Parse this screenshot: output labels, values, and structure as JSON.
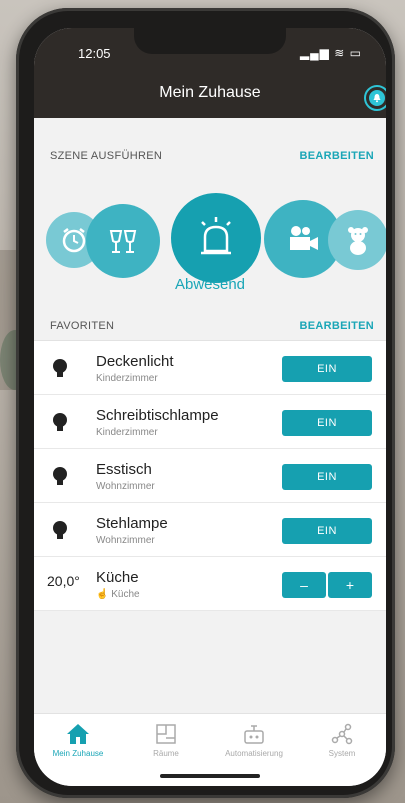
{
  "status_bar": {
    "time": "12:05"
  },
  "header": {
    "title": "Mein Zuhause"
  },
  "scenes": {
    "heading": "SZENE AUSFÜHREN",
    "edit_label": "BEARBEITEN",
    "items": [
      {
        "icon": "alarm-clock-icon"
      },
      {
        "icon": "wine-glasses-icon"
      },
      {
        "icon": "siren-icon",
        "active": true
      },
      {
        "icon": "video-camera-icon"
      },
      {
        "icon": "teddy-bear-icon"
      }
    ],
    "active_label": "Abwesend"
  },
  "favorites": {
    "heading": "FAVORITEN",
    "edit_label": "BEARBEITEN",
    "items": [
      {
        "name": "Deckenlicht",
        "room": "Kinderzimmer",
        "button": "EIN"
      },
      {
        "name": "Schreibtischlampe",
        "room": "Kinderzimmer",
        "button": "EIN"
      },
      {
        "name": "Esstisch",
        "room": "Wohnzimmer",
        "button": "EIN"
      },
      {
        "name": "Stehlampe",
        "room": "Wohnzimmer",
        "button": "EIN"
      }
    ],
    "thermostat": {
      "temp": "20,0°",
      "name": "Küche",
      "room": "Küche",
      "minus": "–",
      "plus": "+"
    }
  },
  "tabs": [
    {
      "label": "Mein Zuhause",
      "icon": "home-icon",
      "active": true
    },
    {
      "label": "Räume",
      "icon": "floorplan-icon"
    },
    {
      "label": "Automatisierung",
      "icon": "robot-icon"
    },
    {
      "label": "System",
      "icon": "network-icon"
    }
  ],
  "colors": {
    "accent": "#16a0b0",
    "header": "#2f2b28"
  }
}
